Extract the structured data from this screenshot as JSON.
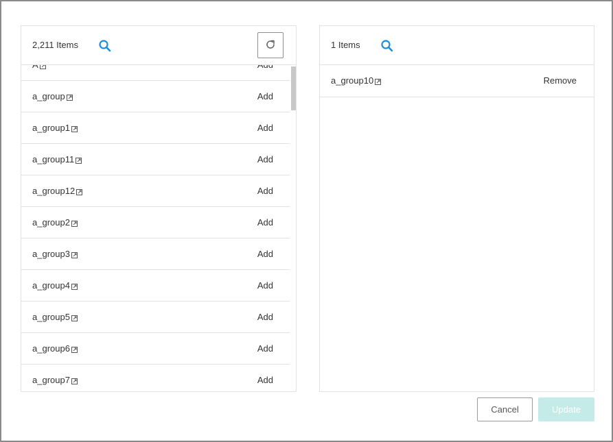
{
  "colors": {
    "accent": "#1a8fd8",
    "update_disabled_bg": "#c4ebe7",
    "border": "#e2e2e2"
  },
  "left_panel": {
    "count_label": "2,211 Items",
    "search_icon": "search-icon",
    "refresh_icon": "refresh-icon",
    "scroll_fraction": 0.05,
    "rows": [
      {
        "name": "A",
        "action": "Add"
      },
      {
        "name": "a_group",
        "action": "Add"
      },
      {
        "name": "a_group1",
        "action": "Add"
      },
      {
        "name": "a_group11",
        "action": "Add"
      },
      {
        "name": "a_group12",
        "action": "Add"
      },
      {
        "name": "a_group2",
        "action": "Add"
      },
      {
        "name": "a_group3",
        "action": "Add"
      },
      {
        "name": "a_group4",
        "action": "Add"
      },
      {
        "name": "a_group5",
        "action": "Add"
      },
      {
        "name": "a_group6",
        "action": "Add"
      },
      {
        "name": "a_group7",
        "action": "Add"
      }
    ]
  },
  "right_panel": {
    "count_label": "1 Items",
    "search_icon": "search-icon",
    "rows": [
      {
        "name": "a_group10",
        "action": "Remove"
      }
    ]
  },
  "footer": {
    "cancel_label": "Cancel",
    "update_label": "Update"
  }
}
